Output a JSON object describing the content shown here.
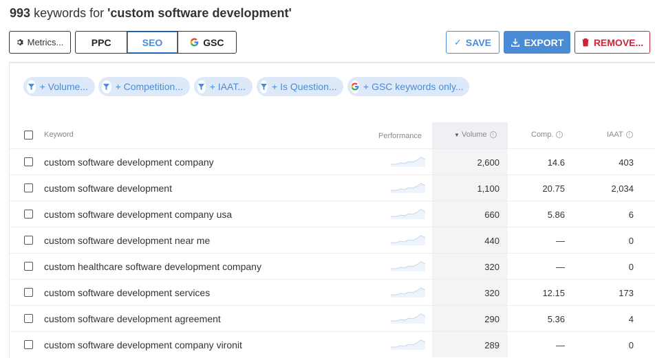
{
  "header": {
    "count": "993",
    "mid": "keywords for",
    "query": "'custom software development'"
  },
  "toolbar": {
    "metrics_label": "Metrics...",
    "tabs": [
      {
        "label": "PPC"
      },
      {
        "label": "SEO",
        "active": true
      },
      {
        "label": "GSC",
        "icon": "google-icon"
      }
    ],
    "save_label": "SAVE",
    "export_label": "EXPORT",
    "remove_label": "REMOVE..."
  },
  "filters": [
    {
      "label": "+ Volume...",
      "icon": "filter-icon"
    },
    {
      "label": "+ Competition...",
      "icon": "filter-icon"
    },
    {
      "label": "+ IAAT...",
      "icon": "filter-icon"
    },
    {
      "label": "+ Is Question...",
      "icon": "filter-icon"
    },
    {
      "label": "+ GSC keywords only...",
      "icon": "google-icon"
    }
  ],
  "table": {
    "headers": {
      "keyword": "Keyword",
      "performance": "Performance",
      "volume": "Volume",
      "comp": "Comp.",
      "iaat": "IAAT"
    },
    "rows": [
      {
        "keyword": "custom software development company",
        "volume": "2,600",
        "comp": "14.6",
        "iaat": "403"
      },
      {
        "keyword": "custom software development",
        "volume": "1,100",
        "comp": "20.75",
        "iaat": "2,034"
      },
      {
        "keyword": "custom software development company usa",
        "volume": "660",
        "comp": "5.86",
        "iaat": "6"
      },
      {
        "keyword": "custom software development near me",
        "volume": "440",
        "comp": "—",
        "iaat": "0"
      },
      {
        "keyword": "custom healthcare software development company",
        "volume": "320",
        "comp": "—",
        "iaat": "0"
      },
      {
        "keyword": "custom software development services",
        "volume": "320",
        "comp": "12.15",
        "iaat": "173"
      },
      {
        "keyword": "custom software development agreement",
        "volume": "290",
        "comp": "5.36",
        "iaat": "4"
      },
      {
        "keyword": "custom software development company vironit",
        "volume": "289",
        "comp": "—",
        "iaat": "0"
      }
    ]
  },
  "colors": {
    "accent": "#4a8bd6",
    "danger": "#c8273b",
    "chip_bg": "#dde9f8"
  }
}
